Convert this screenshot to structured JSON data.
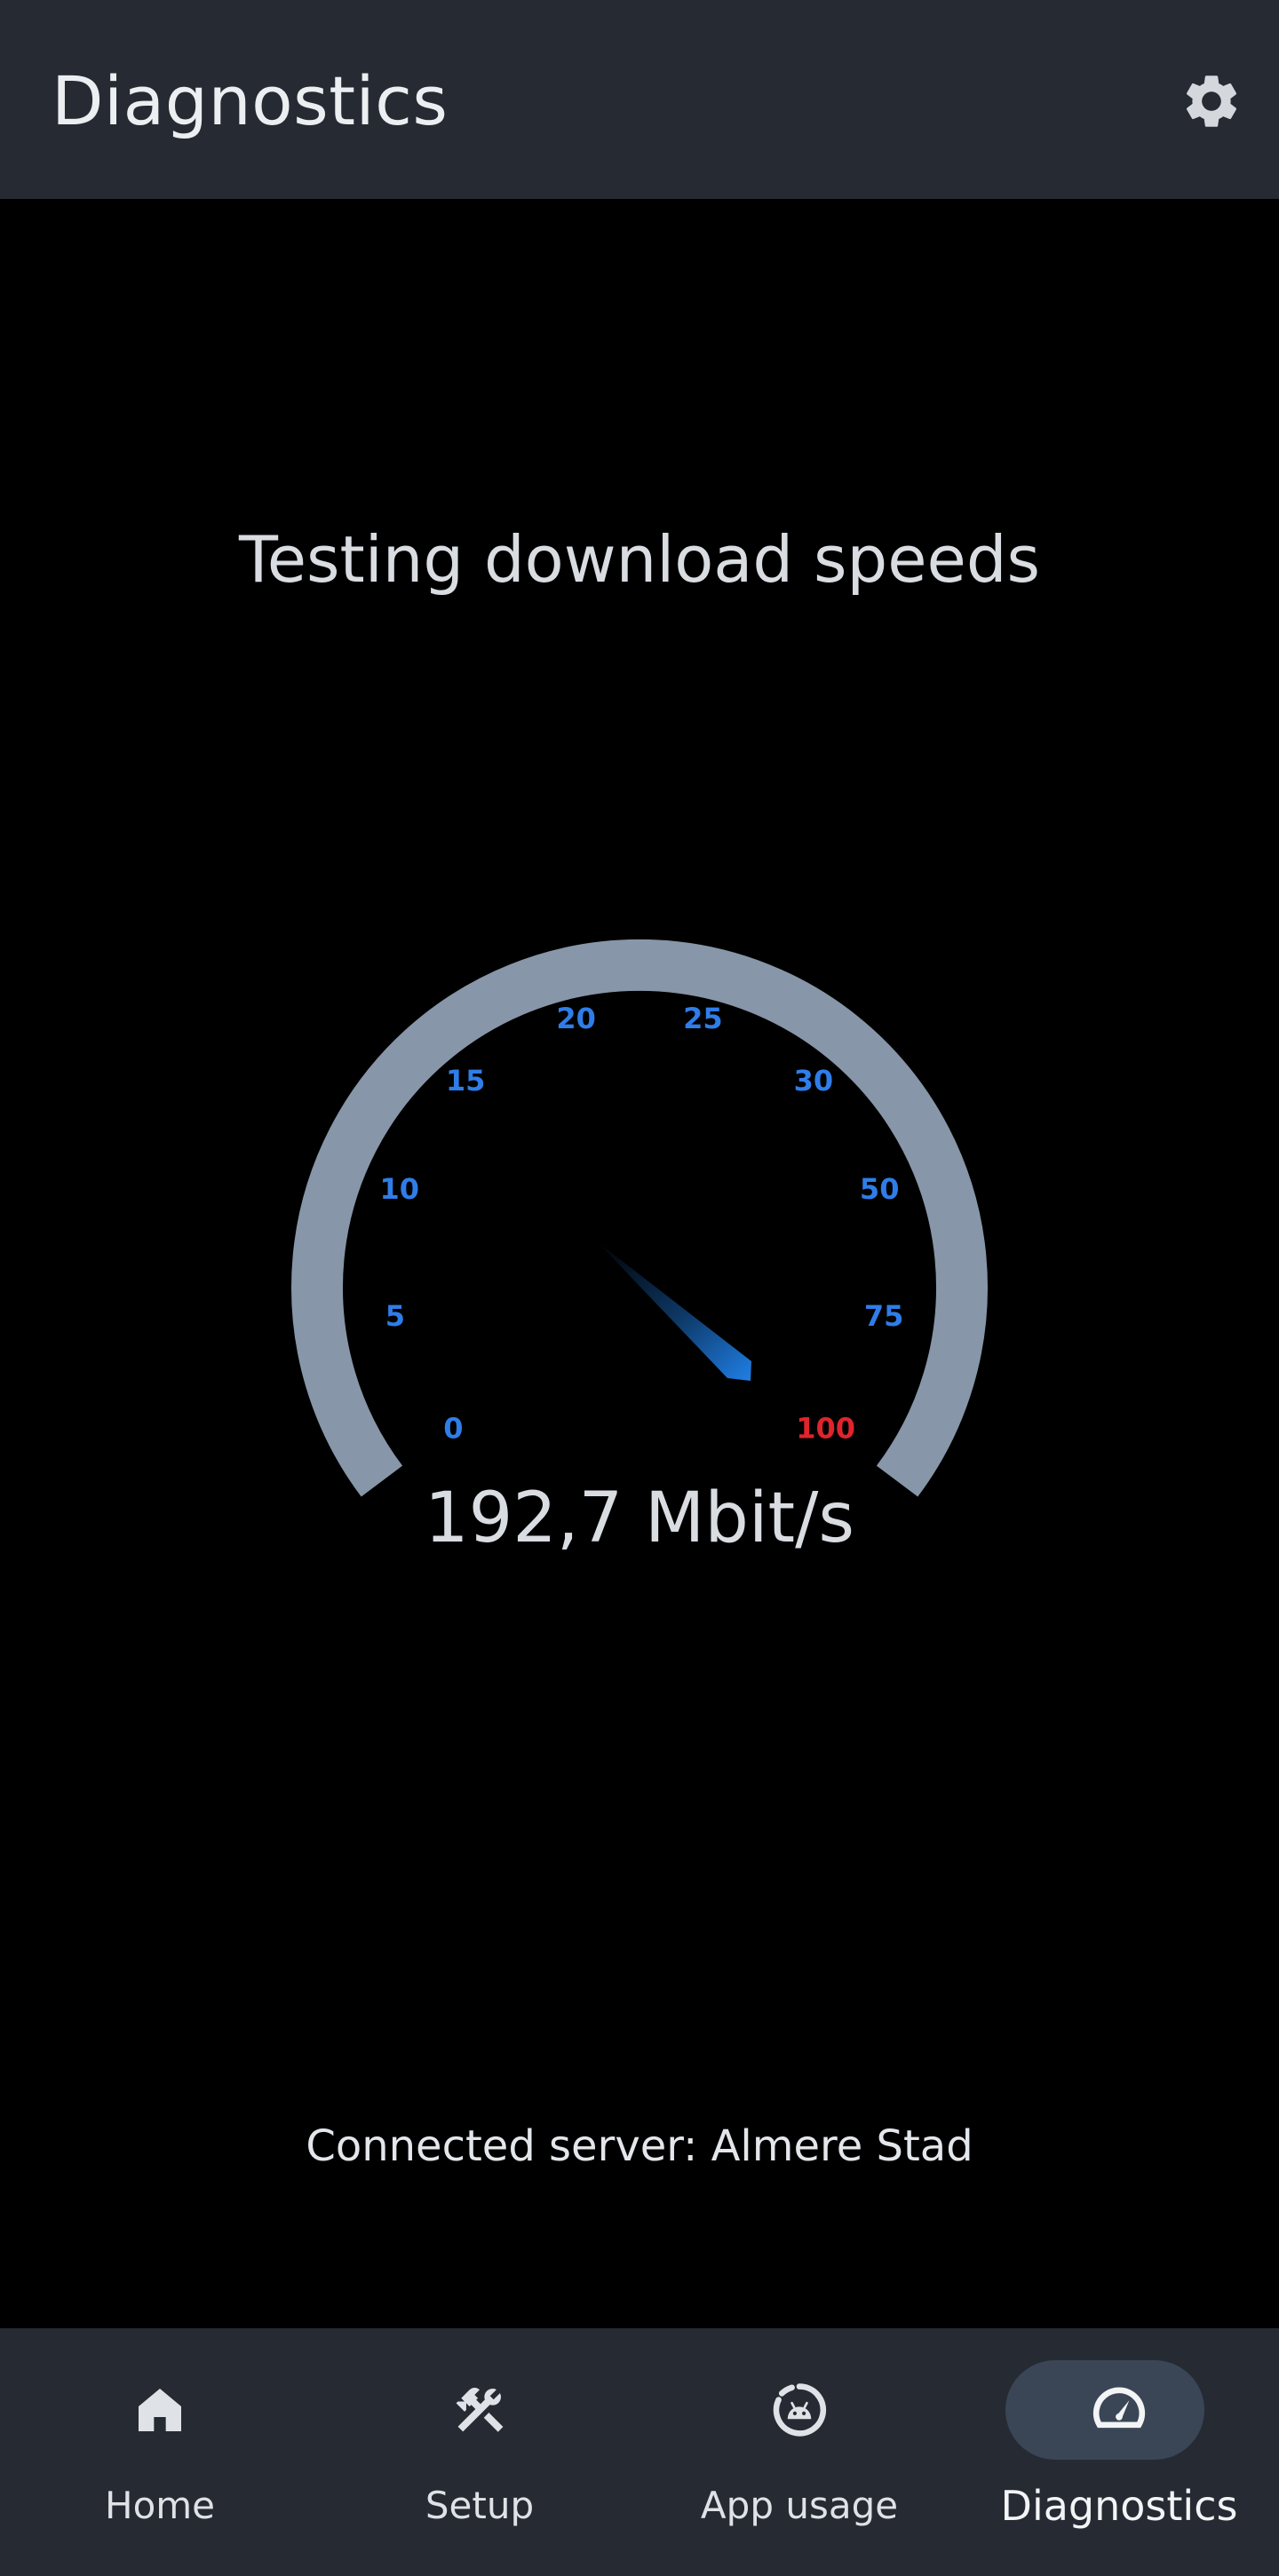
{
  "header": {
    "title": "Diagnostics",
    "settings_icon": "gear-icon"
  },
  "main": {
    "heading": "Testing download speeds",
    "speed_value": "192,7 Mbit/s",
    "server_text": "Connected server: Almere Stad"
  },
  "gauge": {
    "ticks": [
      "0",
      "5",
      "10",
      "15",
      "20",
      "25",
      "30",
      "50",
      "75",
      "100"
    ],
    "needle_value": "100",
    "colors": {
      "arc": "#8796a8",
      "tick": "#2f7de8",
      "tick_max": "#e0242c",
      "needle": "#1f7fe6"
    }
  },
  "bottom_nav": {
    "items": [
      {
        "label": "Home",
        "icon": "home-icon"
      },
      {
        "label": "Setup",
        "icon": "tools-icon"
      },
      {
        "label": "App usage",
        "icon": "app-usage-icon"
      },
      {
        "label": "Diagnostics",
        "icon": "speedometer-icon",
        "active": true
      }
    ]
  },
  "colors": {
    "bar_background": "#262b33",
    "page_background": "#000000",
    "active_pill": "#3a4656"
  }
}
